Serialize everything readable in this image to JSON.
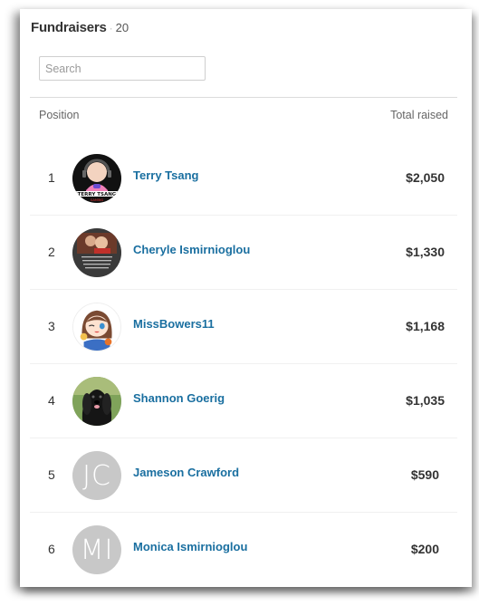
{
  "header": {
    "title": "Fundraisers",
    "separator": "·",
    "count": "20"
  },
  "search": {
    "placeholder": "Search",
    "value": ""
  },
  "columns": {
    "position": "Position",
    "total": "Total raised"
  },
  "fundraisers": [
    {
      "position": "1",
      "name": "Terry Tsang",
      "amount": "$2,050",
      "avatar": "photo-gaming-logo",
      "initials": ""
    },
    {
      "position": "2",
      "name": "Cheryle Ismirnioglou",
      "amount": "$1,330",
      "avatar": "photo-family",
      "initials": ""
    },
    {
      "position": "3",
      "name": "MissBowers11",
      "amount": "$1,168",
      "avatar": "photo-cartoon-girl",
      "initials": ""
    },
    {
      "position": "4",
      "name": "Shannon Goerig",
      "amount": "$1,035",
      "avatar": "photo-dog",
      "initials": ""
    },
    {
      "position": "5",
      "name": "Jameson Crawford",
      "amount": "$590",
      "avatar": "initials",
      "initials": "JC"
    },
    {
      "position": "6",
      "name": "Monica Ismirnioglou",
      "amount": "$200",
      "avatar": "initials",
      "initials": "MI"
    }
  ],
  "colors": {
    "link": "#1a6fa0",
    "avatar_placeholder": "#c8c8c8"
  }
}
